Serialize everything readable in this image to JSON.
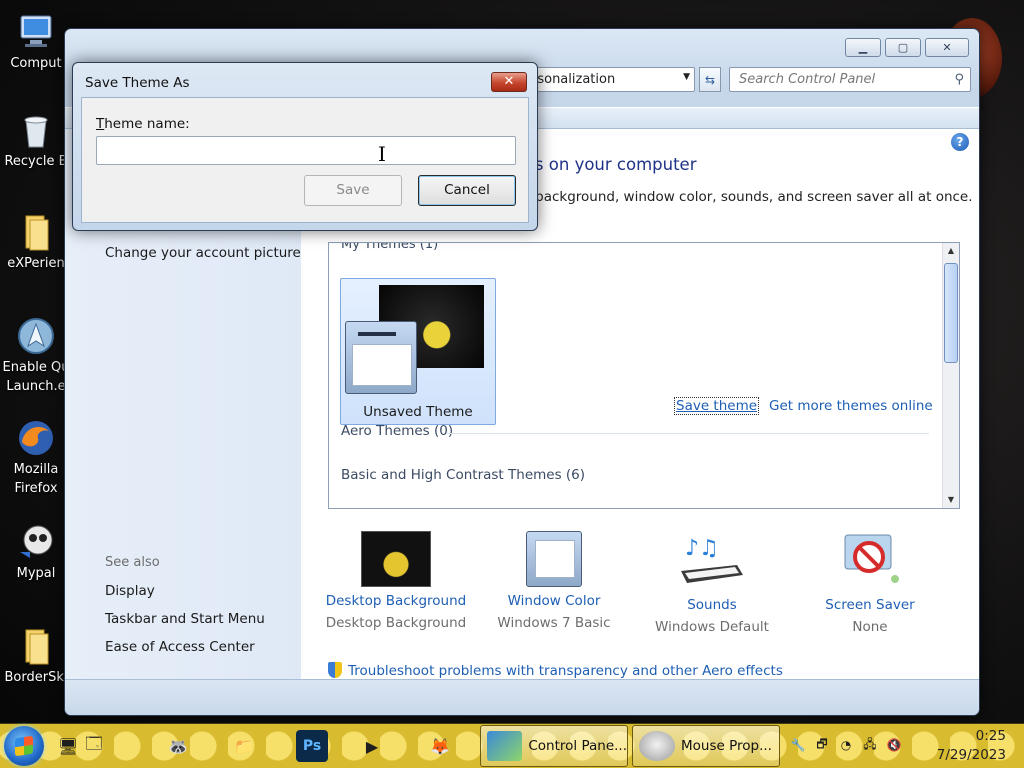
{
  "desktop": {
    "icons": [
      {
        "label": "Comput"
      },
      {
        "label": "Recycle B"
      },
      {
        "label": "eXPerien"
      },
      {
        "label": "Enable Qu\nLaunch.e"
      },
      {
        "label": "Mozilla\nFirefox"
      },
      {
        "label": "Mypal"
      },
      {
        "label": "BorderSki"
      }
    ]
  },
  "main_window": {
    "address_value": "rsonalization",
    "search_placeholder": "Search Control Panel",
    "sidebar": {
      "change_account_picture": "Change your account picture",
      "see_also": "See also",
      "links": [
        "Display",
        "Taskbar and Start Menu",
        "Ease of Access Center"
      ]
    },
    "content": {
      "title": "nds on your computer",
      "description": "op background, window color, sounds, and screen saver all at once.",
      "theme_list": {
        "my_themes_header": "My Themes (1)",
        "tile_name": "Unsaved Theme",
        "save_theme": "Save theme",
        "get_more": "Get more themes online",
        "aero_header": "Aero Themes (0)",
        "basic_header": "Basic and High Contrast Themes (6)"
      },
      "bottom": [
        {
          "link": "Desktop Background",
          "sub": "Desktop Background"
        },
        {
          "link": "Window Color",
          "sub": "Windows 7 Basic"
        },
        {
          "link": "Sounds",
          "sub": "Windows Default"
        },
        {
          "link": "Screen Saver",
          "sub": "None"
        }
      ],
      "troubleshoot": "Troubleshoot problems with transparency and other Aero effects"
    }
  },
  "dialog": {
    "title": "Save Theme As",
    "close_glyph": "✕",
    "label": "Theme name:",
    "input_value": "",
    "save_label": "Save",
    "cancel_label": "Cancel"
  },
  "taskbar": {
    "tasks": [
      {
        "label": "Control Pane..."
      },
      {
        "label": "Mouse Prop..."
      }
    ],
    "clock_time": "0:25",
    "clock_date": "7/29/2023"
  }
}
